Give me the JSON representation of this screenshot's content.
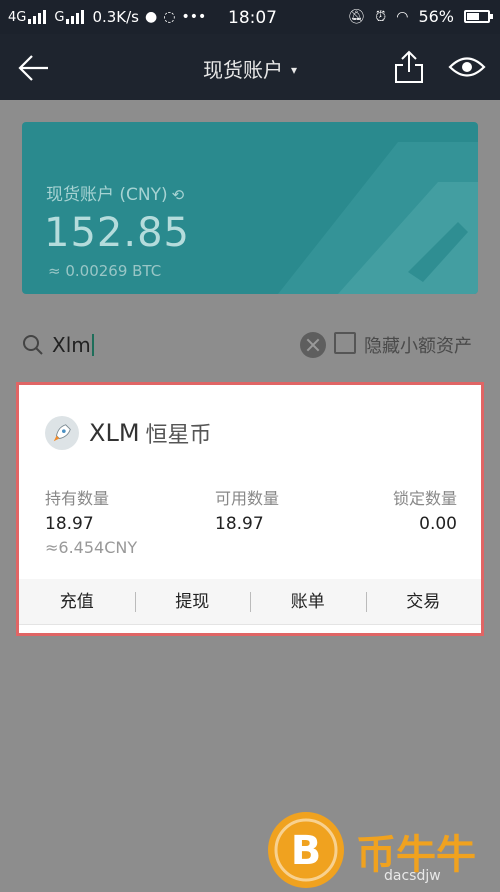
{
  "status_bar": {
    "network1": "4G",
    "network2": "G",
    "speed": "0.3K/s",
    "time": "18:07",
    "battery": "56%"
  },
  "nav": {
    "title": "现货账户",
    "caret": "▾"
  },
  "account": {
    "title": "现货账户 (CNY)",
    "amount": "152.85",
    "btc": "≈ 0.00269 BTC",
    "accent_color": "#2a8a8e"
  },
  "search": {
    "value": "Xlm",
    "hide_small_label": "隐藏小额资产"
  },
  "asset": {
    "symbol": "XLM",
    "name": "恒星币",
    "columns": [
      {
        "label": "持有数量",
        "value": "18.97"
      },
      {
        "label": "可用数量",
        "value": "18.97"
      },
      {
        "label": "锁定数量",
        "value": "0.00"
      }
    ],
    "cny": "≈6.454CNY",
    "highlight_color": "#e06565"
  },
  "actions": [
    "充值",
    "提现",
    "账单",
    "交易"
  ],
  "watermark": {
    "brand": "币牛牛",
    "url": "dacsdjw"
  }
}
